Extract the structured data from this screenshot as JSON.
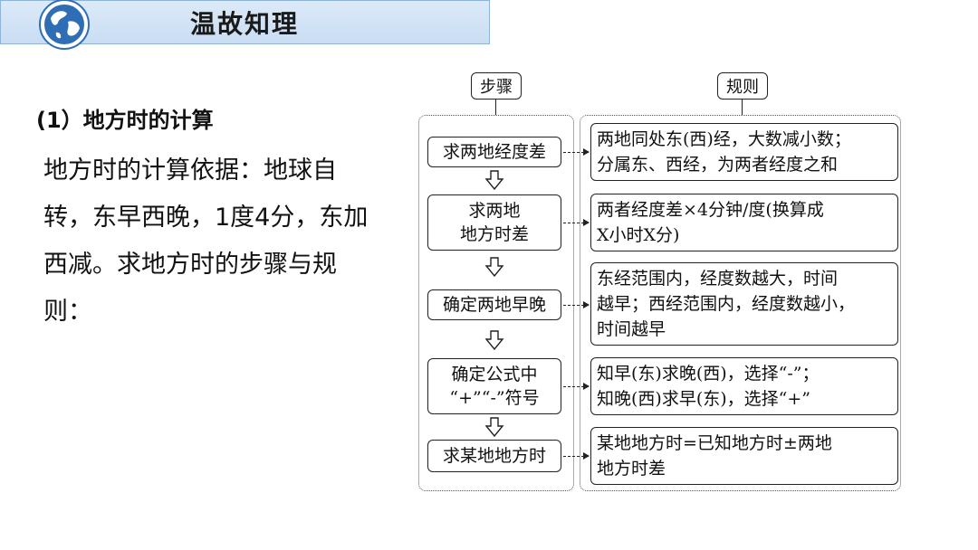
{
  "header": {
    "title": "温故知理"
  },
  "left": {
    "sub_heading": "(1）地方时的计算",
    "body": "地方时的计算依据：地球自转，东早西晚，1度4分，东加西减。求地方时的步骤与规则："
  },
  "diagram": {
    "steps_label": "步骤",
    "rules_label": "规则",
    "steps": [
      {
        "line1": "求两地经度差",
        "line2": ""
      },
      {
        "line1": "求两地",
        "line2": "地方时差"
      },
      {
        "line1": "确定两地早晚",
        "line2": ""
      },
      {
        "line1": "确定公式中",
        "line2": "“+”“-”符号"
      },
      {
        "line1": "求某地地方时",
        "line2": ""
      }
    ],
    "rules": [
      {
        "line1": "两地同处东(西)经，大数减小数；",
        "line2": "分属东、西经，为两者经度之和",
        "line3": ""
      },
      {
        "line1": "两者经度差×4分钟/度(换算成",
        "line2": "X小时X分)",
        "line3": ""
      },
      {
        "line1": "东经范围内，经度数越大，时间",
        "line2": "越早；西经范围内，经度数越小，",
        "line3": "时间越早"
      },
      {
        "line1": "知早(东)求晚(西)，选择“-”；",
        "line2": "知晚(西)求早(东)，选择“+”",
        "line3": ""
      },
      {
        "line1": "某地地方时=已知地方时±两地",
        "line2": "地方时差",
        "line3": ""
      }
    ]
  }
}
